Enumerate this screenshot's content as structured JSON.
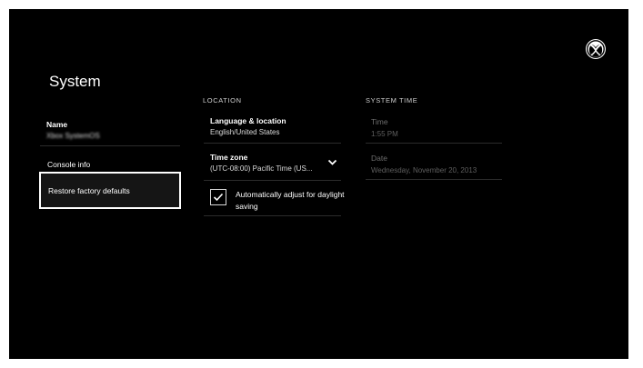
{
  "page": {
    "title": "System"
  },
  "left_menu": {
    "name_label": "Name",
    "name_value": "Xbox SystemOS",
    "console_info": "Console info",
    "restore": "Restore factory defaults"
  },
  "location": {
    "heading": "LOCATION",
    "language_label": "Language & location",
    "language_value": "English/United States",
    "timezone_label": "Time zone",
    "timezone_value": "(UTC-08:00) Pacific Time (US...",
    "auto_adjust_label": "Automatically adjust for daylight saving",
    "auto_adjust_checked": true
  },
  "system_time": {
    "heading": "SYSTEM TIME",
    "time_label": "Time",
    "time_value": "1:55 PM",
    "date_label": "Date",
    "date_value": "Wednesday, November 20, 2013"
  },
  "icons": {
    "logo": "xbox-logo-icon",
    "timezone_dropdown": "chevron-down-icon",
    "checkbox": "checkmark-icon"
  },
  "colors": {
    "background": "#000000",
    "text": "#ffffff",
    "divider": "#2b2b2b",
    "disabled_text": "#6d6d6d"
  }
}
